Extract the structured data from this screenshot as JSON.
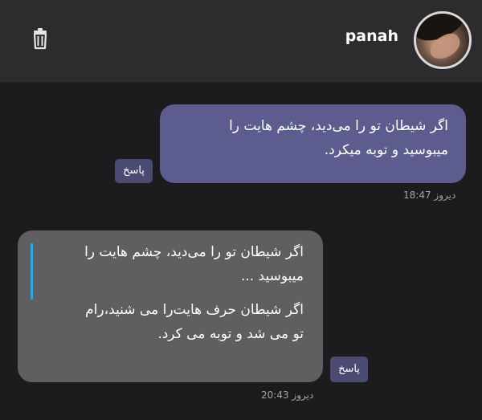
{
  "header": {
    "contact_name": "panah",
    "delete_icon": "trash-icon",
    "avatar_icon": "avatar-photo"
  },
  "messages": [
    {
      "direction": "outgoing",
      "lines": [
        "اگر شیطان تو را می‌دید، چشم هایت را",
        "میبوسید و توبه میکرد."
      ],
      "reply_label": "پاسخ",
      "time": "دیروز 18:47"
    },
    {
      "direction": "incoming",
      "quote_lines": [
        "اگر شیطان تو را می‌دید، چشم هایت را",
        "میبوسید ..."
      ],
      "lines": [
        "اگر شیطان حرف هایت‌را می شنید،رام",
        "تو می شد و توبه می کرد."
      ],
      "reply_label": "پاسخ",
      "time": "دیروز 20:43"
    }
  ],
  "colors": {
    "background": "#1c1c1e",
    "header": "#2c2c2e",
    "outgoing_bubble": "#5c5d8e",
    "incoming_bubble": "#5f5f62",
    "quote_bar": "#2ea7e0",
    "reply_button": "#4a4b72"
  }
}
